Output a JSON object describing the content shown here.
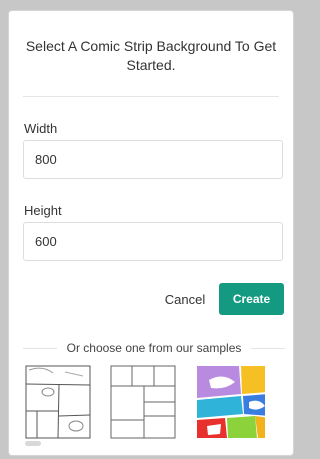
{
  "dialog": {
    "title": "Select A Comic Strip Background To Get Started.",
    "width_label": "Width",
    "width_value": "800",
    "height_label": "Height",
    "height_value": "600",
    "cancel_label": "Cancel",
    "create_label": "Create",
    "create_color": "#159a82",
    "samples_label": "Or choose one from our samples",
    "samples": [
      {
        "icon": "comic-panels-sketch-thumbnail"
      },
      {
        "icon": "comic-panels-grid-thumbnail"
      },
      {
        "icon": "comic-panels-colorful-thumbnail"
      }
    ]
  }
}
